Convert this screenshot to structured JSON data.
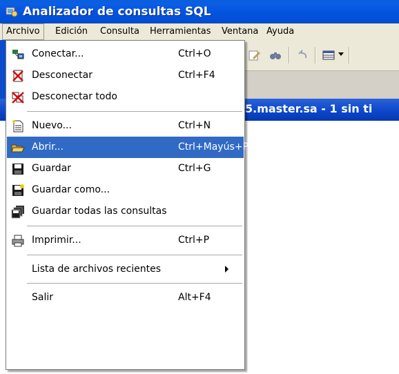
{
  "window": {
    "title": "Analizador de consultas SQL"
  },
  "menubar": {
    "items": [
      "Archivo",
      "Edición",
      "Consulta",
      "Herramientas",
      "Ventana",
      "Ayuda"
    ]
  },
  "background": {
    "mdi_title": "5.master.sa - 1 sin ti"
  },
  "file_menu": {
    "items": [
      {
        "label": "Conectar...",
        "shortcut": "Ctrl+O",
        "icon": "connect-icon"
      },
      {
        "label": "Desconectar",
        "shortcut": "Ctrl+F4",
        "icon": "disconnect-icon"
      },
      {
        "label": "Desconectar todo",
        "shortcut": "",
        "icon": "disconnect-all-icon"
      },
      {
        "label": "Nuevo...",
        "shortcut": "Ctrl+N",
        "icon": "new-document-icon"
      },
      {
        "label": "Abrir...",
        "shortcut": "Ctrl+Mayús+P",
        "icon": "open-folder-icon",
        "highlighted": true
      },
      {
        "label": "Guardar",
        "shortcut": "Ctrl+G",
        "icon": "save-icon"
      },
      {
        "label": "Guardar como...",
        "shortcut": "",
        "icon": "save-as-icon"
      },
      {
        "label": "Guardar todas las consultas",
        "shortcut": "",
        "icon": "save-all-icon"
      },
      {
        "label": "Imprimir...",
        "shortcut": "Ctrl+P",
        "icon": "print-icon"
      },
      {
        "label": "Lista de archivos recientes",
        "shortcut": "",
        "icon": "",
        "submenu": true
      },
      {
        "label": "Salir",
        "shortcut": "Alt+F4",
        "icon": ""
      }
    ]
  },
  "colors": {
    "highlight": "#316ac5",
    "titlebar": "#0454e0"
  }
}
